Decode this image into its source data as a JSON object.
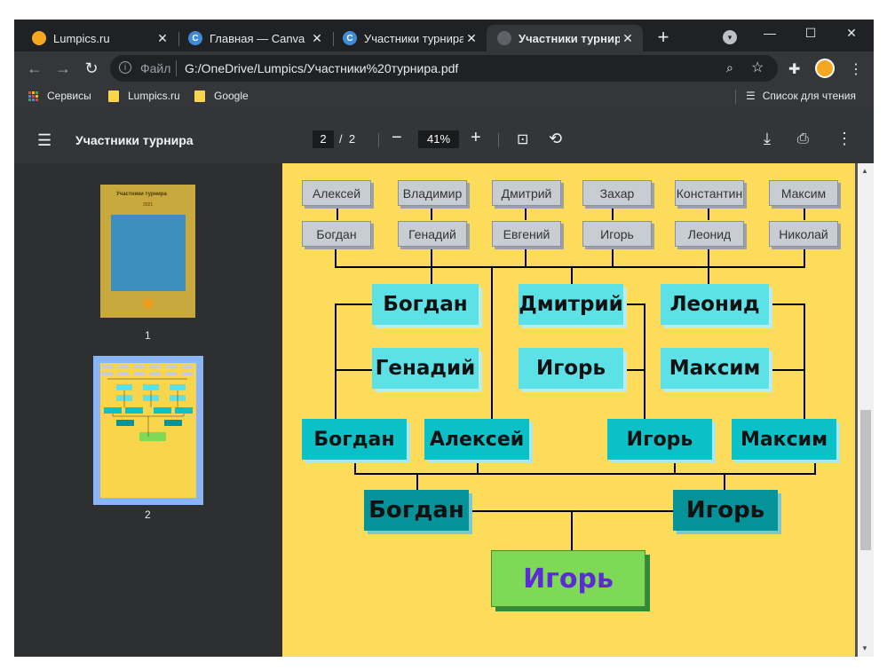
{
  "browser": {
    "tabs": [
      {
        "label": "Lumpics.ru",
        "active": false,
        "icon": "orange-icon",
        "icon_color": "#f5a623"
      },
      {
        "label": "Главная — Canva",
        "active": false,
        "icon": "canva-icon",
        "icon_color": "#7d2ae8"
      },
      {
        "label": "Участники турнира",
        "active": false,
        "icon": "canva-icon",
        "icon_color": "#7d2ae8"
      },
      {
        "label": "Участники турнира",
        "active": true,
        "icon": "globe-icon",
        "icon_color": "#9aa0a6"
      }
    ],
    "close_glyph": "✕",
    "new_tab_glyph": "+",
    "window_controls": {
      "minimize": "—",
      "maximize": "☐",
      "close": "✕"
    },
    "omnibox": {
      "scheme_label": "Файл",
      "url": "G:/OneDrive/Lumpics/Участники%20турнира.pdf"
    },
    "bookmarks": [
      {
        "label": "Сервисы",
        "icon": "apps-grid-icon"
      },
      {
        "label": "Lumpics.ru",
        "icon": "folder-icon"
      },
      {
        "label": "Google",
        "icon": "folder-icon"
      }
    ],
    "reading_list": "Список для чтения"
  },
  "pdf": {
    "title": "Участники турнира",
    "current_page": "2",
    "page_separator": "/",
    "total_pages": "2",
    "zoom": "41%",
    "thumbnails": [
      {
        "page": "1",
        "title": "Участники турнира",
        "subtitle": "2021"
      },
      {
        "page": "2"
      }
    ]
  },
  "bracket": {
    "round1": [
      [
        "Алексей",
        "Богдан"
      ],
      [
        "Владимир",
        "Генадий"
      ],
      [
        "Дмитрий",
        "Евгений"
      ],
      [
        "Захар",
        "Игорь"
      ],
      [
        "Константин",
        "Леонид"
      ],
      [
        "Максим",
        "Николай"
      ]
    ],
    "round2": [
      [
        "Богдан",
        "Генадий"
      ],
      [
        "Дмитрий",
        "Игорь"
      ],
      [
        "Леонид",
        "Максим"
      ]
    ],
    "round3": [
      "Богдан",
      "Алексей",
      "Игорь",
      "Максим"
    ],
    "final": [
      "Богдан",
      "Игорь"
    ],
    "winner": "Игорь"
  },
  "colors": {
    "page_bg": "#fddc5c",
    "round1_box": "#c8cdd3",
    "round2_box": "#5ce1e6",
    "round3_box": "#0cc0c8",
    "final_box": "#05939a",
    "winner_box": "#7ed957",
    "winner_text": "#5b2bd6"
  }
}
